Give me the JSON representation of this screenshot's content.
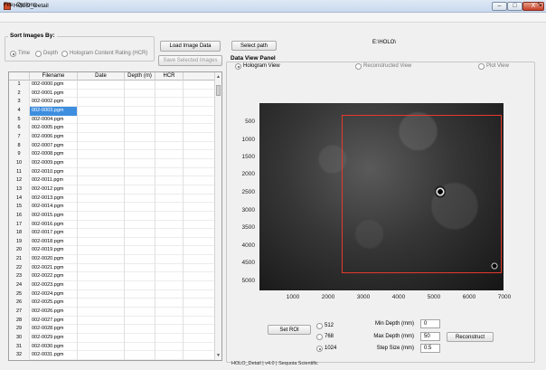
{
  "window": {
    "title": "HOLO_Detail",
    "controls": [
      "–",
      "□",
      "X"
    ]
  },
  "menu": {
    "items": [
      "File",
      "Options"
    ],
    "overflow_arrow": "➘"
  },
  "sort": {
    "title": "Sort Images By:",
    "options": [
      "Time",
      "Depth",
      "Hologram Content Rating (HCR)"
    ],
    "selected": "Time"
  },
  "buttons": {
    "load": "Load Image Data",
    "save": "Save Selected Images",
    "select_path": "Select path",
    "set_roi": "Set ROI",
    "reconstruct": "Reconstruct"
  },
  "path": "E:\\HOLO\\",
  "table": {
    "columns": [
      "Filename",
      "Date",
      "Depth (m)",
      "HCR"
    ],
    "selected_row": 4,
    "rows": [
      {
        "n": "1",
        "file": "002-0000.pgm"
      },
      {
        "n": "2",
        "file": "002-0001.pgm"
      },
      {
        "n": "3",
        "file": "002-0002.pgm"
      },
      {
        "n": "4",
        "file": "002-0003.pgm"
      },
      {
        "n": "5",
        "file": "002-0004.pgm"
      },
      {
        "n": "6",
        "file": "002-0005.pgm"
      },
      {
        "n": "7",
        "file": "002-0006.pgm"
      },
      {
        "n": "8",
        "file": "002-0007.pgm"
      },
      {
        "n": "9",
        "file": "002-0008.pgm"
      },
      {
        "n": "10",
        "file": "002-0009.pgm"
      },
      {
        "n": "11",
        "file": "002-0010.pgm"
      },
      {
        "n": "12",
        "file": "002-0011.pgm"
      },
      {
        "n": "13",
        "file": "002-0012.pgm"
      },
      {
        "n": "14",
        "file": "002-0013.pgm"
      },
      {
        "n": "15",
        "file": "002-0014.pgm"
      },
      {
        "n": "16",
        "file": "002-0015.pgm"
      },
      {
        "n": "17",
        "file": "002-0016.pgm"
      },
      {
        "n": "18",
        "file": "002-0017.pgm"
      },
      {
        "n": "19",
        "file": "002-0018.pgm"
      },
      {
        "n": "20",
        "file": "002-0019.pgm"
      },
      {
        "n": "21",
        "file": "002-0020.pgm"
      },
      {
        "n": "22",
        "file": "002-0021.pgm"
      },
      {
        "n": "23",
        "file": "002-0022.pgm"
      },
      {
        "n": "24",
        "file": "002-0023.pgm"
      },
      {
        "n": "25",
        "file": "002-0024.pgm"
      },
      {
        "n": "26",
        "file": "002-0025.pgm"
      },
      {
        "n": "27",
        "file": "002-0026.pgm"
      },
      {
        "n": "28",
        "file": "002-0027.pgm"
      },
      {
        "n": "29",
        "file": "002-0028.pgm"
      },
      {
        "n": "30",
        "file": "002-0029.pgm"
      },
      {
        "n": "31",
        "file": "002-0030.pgm"
      },
      {
        "n": "32",
        "file": "002-0031.pgm"
      }
    ]
  },
  "data_view": {
    "title": "Data View Panel",
    "views": [
      "Hologram View",
      "Reconstructed View",
      "Plot View"
    ],
    "selected_view": "Hologram View",
    "y_ticks": [
      "500",
      "1000",
      "1500",
      "2000",
      "2500",
      "3000",
      "3500",
      "4000",
      "4500",
      "5000"
    ],
    "x_ticks": [
      "1000",
      "2000",
      "3000",
      "4000",
      "5000",
      "6000",
      "7000"
    ]
  },
  "roi_sizes": {
    "options": [
      "512",
      "768",
      "1024"
    ],
    "selected": "1024"
  },
  "depth": {
    "min_label": "Min Depth (mm)",
    "min_value": "0",
    "max_label": "Max Depth (mm)",
    "max_value": "50",
    "step_label": "Step Size (mm)",
    "step_value": "0.5"
  },
  "footer": "HOLO_Detail | v4.0 | Sequoia Scientific",
  "colors": {
    "roi": "#e33a2e",
    "selection": "#3e8ee0"
  }
}
